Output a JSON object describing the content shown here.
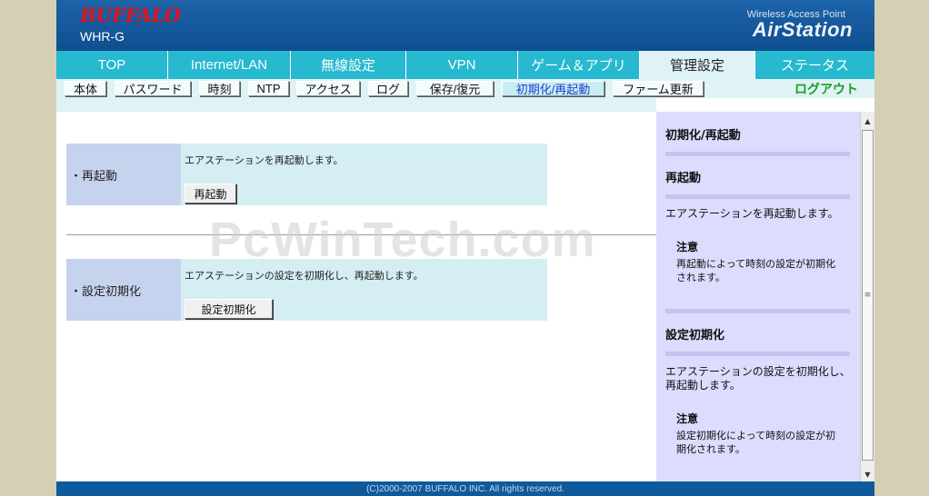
{
  "header": {
    "brand": "BUFFALO",
    "model": "WHR-G",
    "tagline": "Wireless Access Point",
    "product": "AirStation"
  },
  "tabs": [
    {
      "label": "TOP",
      "active": false
    },
    {
      "label": "Internet/LAN",
      "active": false
    },
    {
      "label": "無線設定",
      "active": false
    },
    {
      "label": "VPN",
      "active": false
    },
    {
      "label": "ゲーム＆アプリ",
      "active": false
    },
    {
      "label": "管理設定",
      "active": true
    },
    {
      "label": "ステータス",
      "active": false
    }
  ],
  "submenu": [
    {
      "label": "本体",
      "active": false
    },
    {
      "label": "パスワード",
      "active": false
    },
    {
      "label": "時刻",
      "active": false
    },
    {
      "label": "NTP",
      "active": false
    },
    {
      "label": "アクセス",
      "active": false
    },
    {
      "label": "ログ",
      "active": false
    },
    {
      "label": "保存/復元",
      "active": false
    },
    {
      "label": "初期化/再起動",
      "active": true
    },
    {
      "label": "ファーム更新",
      "active": false
    }
  ],
  "logout_label": "ログアウト",
  "watermark": "PcWinTech.com",
  "sections": {
    "restart": {
      "label": "・再起動",
      "description": "エアステーションを再起動します。",
      "button": "再起動"
    },
    "reset": {
      "label": "・設定初期化",
      "description": "エアステーションの設定を初期化し、再起動します。",
      "button": "設定初期化"
    }
  },
  "help": {
    "title": "初期化/再起動",
    "restart": {
      "heading": "再起動",
      "text": "エアステーションを再起動します。",
      "note_title": "注意",
      "note_line1": "再起動によって時刻の設定が初期化",
      "note_line2": "されます。"
    },
    "reset": {
      "heading": "設定初期化",
      "text_line1": "エアステーションの設定を初期化し、",
      "text_line2": "再起動します。",
      "note_title": "注意",
      "note_line1": "設定初期化によって時刻の設定が初",
      "note_line2": "期化されます。"
    }
  },
  "footer": "(C)2000-2007 BUFFALO INC. All rights reserved.",
  "colors": {
    "header": "#0e4f90",
    "tab_bar": "#26b9cf",
    "active_tab": "#dff3f6",
    "logout": "#15a020",
    "help_panel": "#dcdcff"
  }
}
